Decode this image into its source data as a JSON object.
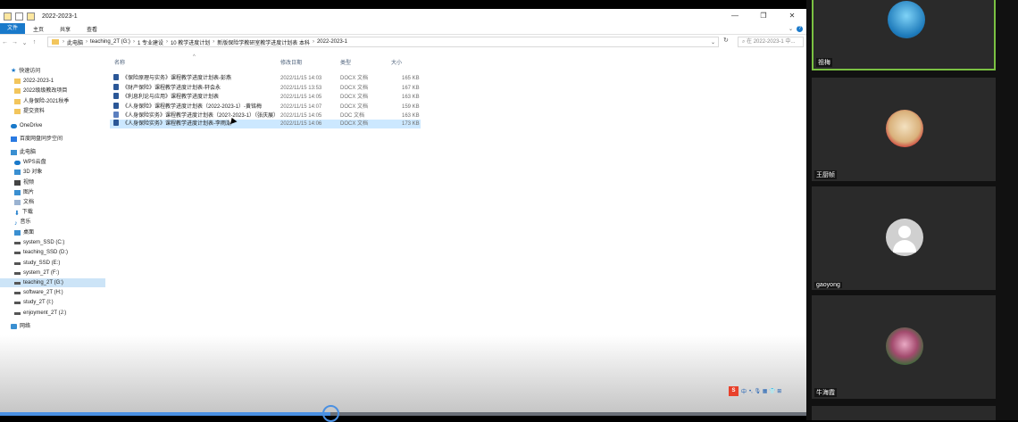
{
  "window": {
    "title": "2022-2023-1",
    "ribbon_tabs": [
      "文件",
      "主页",
      "共享",
      "查看"
    ],
    "controls": {
      "minimize": "—",
      "maximize": "❐",
      "close": "✕"
    }
  },
  "nav_buttons": {
    "back": "←",
    "forward": "→",
    "up_list": "⌄",
    "up": "↑"
  },
  "address": {
    "crumbs": [
      "此电脑",
      "teaching_2T (G:)",
      "1 专业建设",
      "10 教学进度计划",
      "新版保险学教研室教学进度计划表 本科",
      "2022-2023-1"
    ],
    "search_placeholder": "在 2022-2023-1 中..."
  },
  "sidebar": {
    "items": [
      {
        "label": "快速访问",
        "icon": "star-icon"
      },
      {
        "label": "2022-2023-1",
        "icon": "folder-icon"
      },
      {
        "label": "2022级级教改项目",
        "icon": "folder-icon"
      },
      {
        "label": "人身保险-2021秋季",
        "icon": "folder-icon"
      },
      {
        "label": "提交资料",
        "icon": "folder-icon"
      },
      {
        "label": "OneDrive",
        "icon": "cloud-icon"
      },
      {
        "label": "百度网盘同步空间",
        "icon": "baidu-icon"
      },
      {
        "label": "此电脑",
        "icon": "pc-icon"
      },
      {
        "label": "WPS云盘",
        "icon": "cloud-icon"
      },
      {
        "label": "3D 对象",
        "icon": "cube-icon"
      },
      {
        "label": "视频",
        "icon": "video-icon"
      },
      {
        "label": "图片",
        "icon": "picture-icon"
      },
      {
        "label": "文档",
        "icon": "document-icon"
      },
      {
        "label": "下载",
        "icon": "download-icon"
      },
      {
        "label": "音乐",
        "icon": "music-icon"
      },
      {
        "label": "桌面",
        "icon": "desktop-icon"
      },
      {
        "label": "system_SSD (C:)",
        "icon": "drive-icon"
      },
      {
        "label": "teaching_SSD (D:)",
        "icon": "drive-icon"
      },
      {
        "label": "study_SSD (E:)",
        "icon": "drive-icon"
      },
      {
        "label": "system_2T (F:)",
        "icon": "drive-icon"
      },
      {
        "label": "teaching_2T (G:)",
        "icon": "drive-icon"
      },
      {
        "label": "software_2T (H:)",
        "icon": "drive-icon"
      },
      {
        "label": "study_2T (I:)",
        "icon": "drive-icon"
      },
      {
        "label": "enjoyment_2T (J:)",
        "icon": "drive-icon"
      },
      {
        "label": "网络",
        "icon": "network-icon"
      }
    ]
  },
  "files": {
    "headers": {
      "name": "名称",
      "date": "修改日期",
      "type": "类型",
      "size": "大小"
    },
    "rows": [
      {
        "name": "《保险原理与实务》课程教学进度计划表-彭燕",
        "date": "2022/11/15 14:03",
        "type": "DOCX 文档",
        "size": "165 KB"
      },
      {
        "name": "《财产保险》课程教学进度计划表-轩会永",
        "date": "2022/11/15 13:53",
        "type": "DOCX 文档",
        "size": "167 KB"
      },
      {
        "name": "《利息利论与应用》课程教学进度计划表",
        "date": "2022/11/15 14:05",
        "type": "DOCX 文档",
        "size": "163 KB"
      },
      {
        "name": "《人身保险》课程教学进度计划表（2022-2023-1）-黄铭梅",
        "date": "2022/11/15 14:07",
        "type": "DOCX 文档",
        "size": "159 KB"
      },
      {
        "name": "《人身保险实务》课程教学进度计划表（2022-2023-1）（张庆展）",
        "date": "2022/11/15 14:05",
        "type": "DOC 文档",
        "size": "163 KB"
      },
      {
        "name": "《人身保险实务》课程教学进度计划表-李雨潮",
        "date": "2022/11/15 14:06",
        "type": "DOCX 文档",
        "size": "173 KB"
      }
    ]
  },
  "tray": {
    "ime": "S",
    "lang": "中",
    "icons": "•, 🎙 ▦ 👕 ⊞"
  },
  "video_progress": 0.41,
  "participants": [
    {
      "name": "祖梅",
      "avatar": "blue-balloon"
    },
    {
      "name": "王厨帧",
      "avatar": "red-text-figure"
    },
    {
      "name": "gaoyong",
      "avatar": "default-gray"
    },
    {
      "name": "牛海霞",
      "avatar": "flower"
    }
  ],
  "colors": {
    "accent": "#1979ca",
    "active_border": "#7ac142",
    "selection": "#cce8ff"
  }
}
